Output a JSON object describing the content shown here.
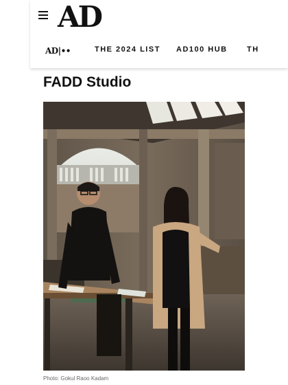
{
  "header": {
    "logo": "AD",
    "menu_icon": "hamburger-menu-icon"
  },
  "nav": {
    "ad100_badge": "AD|••",
    "items": [
      {
        "label": "THE 2024 LIST"
      },
      {
        "label": "AD100 HUB"
      },
      {
        "label": "TH"
      }
    ]
  },
  "article": {
    "title": "FADD Studio",
    "caption": "Photo: Gokul Raoo Kadam"
  },
  "colors": {
    "background": "#ffffff",
    "text": "#111111",
    "caption": "#666666"
  }
}
